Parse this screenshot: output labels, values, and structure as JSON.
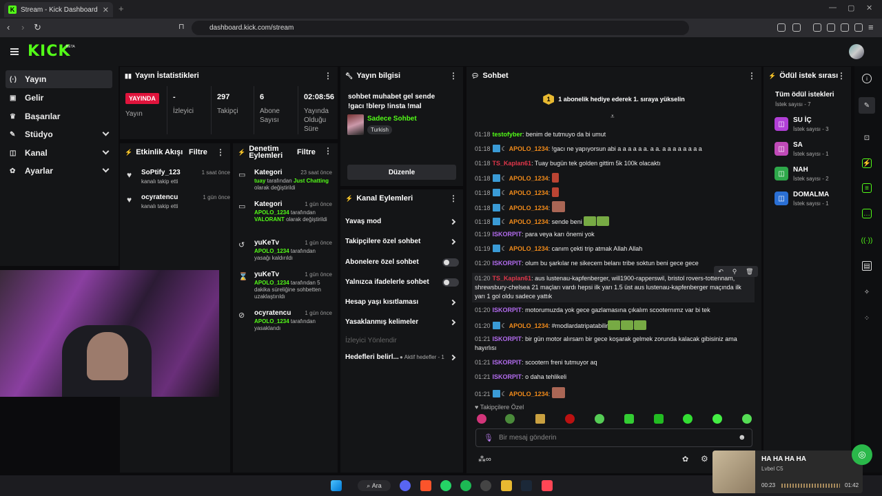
{
  "browser": {
    "tab_title": "Stream - Kick Dashboard",
    "url": "dashboard.kick.com/stream"
  },
  "app": {
    "logo": "KICK",
    "beta": "BETA"
  },
  "sidebar": {
    "items": [
      {
        "label": "Yayın",
        "icon": "broadcast-icon"
      },
      {
        "label": "Gelir",
        "icon": "wallet-icon"
      },
      {
        "label": "Başarılar",
        "icon": "trophy-icon"
      },
      {
        "label": "Stüdyo",
        "icon": "studio-icon"
      },
      {
        "label": "Kanal",
        "icon": "channel-icon"
      },
      {
        "label": "Ayarlar",
        "icon": "gear-icon"
      }
    ]
  },
  "stats": {
    "title": "Yayın İstatistikleri",
    "cells": [
      {
        "value": "YAYINDA",
        "label": "Yayın"
      },
      {
        "value": "-",
        "label": "İzleyici"
      },
      {
        "value": "297",
        "label": "Takipçi"
      },
      {
        "value": "6",
        "label": "Abone Sayısı"
      },
      {
        "value": "02:08:56",
        "label": "Yayında Olduğu Süre"
      }
    ]
  },
  "activity": {
    "title": "Etkinlik Akışı",
    "filter": "Filtre",
    "items": [
      {
        "name": "SoPtify_123",
        "sub": "kanalı takip etti",
        "time": "1 saat önce"
      },
      {
        "name": "ocyratencu",
        "sub": "kanalı takip etti",
        "time": "1 gün önce"
      }
    ]
  },
  "moderation": {
    "title": "Denetim Eylemleri",
    "filter": "Filtre",
    "items": [
      {
        "name": "Kategori",
        "time": "23 saat önce",
        "actor": "tuay",
        "mid": " tarafından ",
        "target": "Just Chatting",
        "tail": " olarak değiştirildi"
      },
      {
        "name": "Kategori",
        "time": "1 gün önce",
        "actor": "APOLO_1234",
        "mid": " tarafından ",
        "target": "VALORANT",
        "tail": " olarak değiştirildi"
      },
      {
        "name": "yuKeTv",
        "time": "1 gün önce",
        "actor": "APOLO_1234",
        "mid": " tarafından yasağı kaldırıldı",
        "target": "",
        "tail": ""
      },
      {
        "name": "yuKeTv",
        "time": "1 gün önce",
        "actor": "APOLO_1234",
        "mid": " tarafından 5 dakika süreliğine sohbetten uzaklaştırıldı",
        "target": "",
        "tail": ""
      },
      {
        "name": "ocyratencu",
        "time": "1 gün önce",
        "actor": "APOLO_1234",
        "mid": " tarafından yasaklandı",
        "target": "",
        "tail": ""
      }
    ]
  },
  "stream_info": {
    "title": "Yayın bilgisi",
    "stream_title": "sohbet muhabet gel sende !gacı !blerp !insta !mal",
    "category": "Sadece Sohbet",
    "language": "Turkish",
    "edit_label": "Düzenle"
  },
  "channel_actions": {
    "title": "Kanal Eylemleri",
    "items": [
      {
        "label": "Yavaş mod",
        "kind": "chevron"
      },
      {
        "label": "Takipçilere özel sohbet",
        "kind": "chevron"
      },
      {
        "label": "Abonelere özel sohbet",
        "kind": "toggle"
      },
      {
        "label": "Yalnızca ifadelerle sohbet",
        "kind": "toggle"
      },
      {
        "label": "Hesap yaşı kısıtlaması",
        "kind": "chevron"
      },
      {
        "label": "Yasaklanmış kelimeler",
        "kind": "chevron"
      },
      {
        "label": "İzleyici Yönlendir",
        "kind": "disabled"
      },
      {
        "label": "Hedefleri belirl...",
        "kind": "chevron"
      }
    ],
    "goal_tag": "● Aktif hedefler - 1"
  },
  "chat": {
    "title": "Sohbet",
    "pinned": "1 abonelik hediye ederek 1. sıraya yükselin",
    "pinned_number": "1",
    "messages": [
      {
        "time": "01:18",
        "user": "testofyber",
        "color": "#53fc18",
        "badges": false,
        "text": "benim de tutmuyo da bi umut"
      },
      {
        "time": "01:18",
        "user": "APOLO_1234",
        "color": "#f08a1a",
        "badges": true,
        "text": "!gacı ne yapıyorsun abi a a a a a a. a a. a a a a a a a a"
      },
      {
        "time": "01:18",
        "user": "TS_Kaplan61",
        "color": "#e0364a",
        "badges": false,
        "text": "Tuay bugün tek golden gittim 5k 100k olacaktı"
      },
      {
        "time": "01:18",
        "user": "APOLO_1234",
        "color": "#f08a1a",
        "badges": true,
        "text": "",
        "emote": "red"
      },
      {
        "time": "01:18",
        "user": "APOLO_1234",
        "color": "#f08a1a",
        "badges": true,
        "text": "",
        "emote": "red"
      },
      {
        "time": "01:18",
        "user": "APOLO_1234",
        "color": "#f08a1a",
        "badges": true,
        "text": "",
        "emote": "pic"
      },
      {
        "time": "01:18",
        "user": "APOLO_1234",
        "color": "#f08a1a",
        "badges": true,
        "text": "sende beni",
        "emote": "green2"
      },
      {
        "time": "01:19",
        "user": "ISKORPIT",
        "color": "#b46cf0",
        "badges": false,
        "text": "para veya karı önemi yok"
      },
      {
        "time": "01:19",
        "user": "APOLO_1234",
        "color": "#f08a1a",
        "badges": true,
        "text": "canım çekti trip atmak Allah Allah"
      },
      {
        "time": "01:20",
        "user": "ISKORPIT",
        "color": "#b46cf0",
        "badges": false,
        "text": "olum bu şarkılar ne sikecem belanı tribe soktun beni gece gece"
      },
      {
        "time": "01:20",
        "user": "TS_Kaplan61",
        "color": "#e0364a",
        "badges": false,
        "text": "aus lustenau-kapfenberger, will1900-rapperswil, bristol rovers-tottenham, shrewsbury-chelsea 21 maçları vardı hepsi ilk yarı 1.5 üst aus lustenau-kapfenberger maçında ilk yarı 1 gol oldu sadece yattık",
        "highlight": true
      },
      {
        "time": "01:20",
        "user": "ISKORPIT",
        "color": "#b46cf0",
        "badges": false,
        "text": "motorumuzda yok gece gazlamasına çıkalım scooternımz var bi tek"
      },
      {
        "time": "01:20",
        "user": "APOLO_1234",
        "color": "#f08a1a",
        "badges": true,
        "text": "#modlardatripatabilir",
        "emote": "green3"
      },
      {
        "time": "01:21",
        "user": "ISKORPIT",
        "color": "#b46cf0",
        "badges": false,
        "text": "bir gün motor alırsam bir gece koşarak gelmek zorunda kalacak gibisiniz ama hayırlısı"
      },
      {
        "time": "01:21",
        "user": "ISKORPIT",
        "color": "#b46cf0",
        "badges": false,
        "text": "scootern freni tutmuyor aq"
      },
      {
        "time": "01:21",
        "user": "ISKORPIT",
        "color": "#b46cf0",
        "badges": false,
        "text": "o daha tehlikeli"
      },
      {
        "time": "01:21",
        "user": "APOLO_1234",
        "color": "#f08a1a",
        "badges": true,
        "text": "",
        "emote": "pic"
      }
    ],
    "followers_only": "Takipçilere Özel",
    "input_placeholder": "Bir mesaj gönderin"
  },
  "rewards": {
    "title": "Ödül istek sırası",
    "all_label": "Tüm ödül istekleri",
    "all_count": "İstek sayısı - 7",
    "items": [
      {
        "name": "SU İÇ",
        "count": "İstek sayısı - 3",
        "color": "#b13fd6"
      },
      {
        "name": "SA",
        "count": "İstek sayısı - 1",
        "color": "#c04ab8"
      },
      {
        "name": "NAH",
        "count": "İstek sayısı - 2",
        "color": "#2ea84a"
      },
      {
        "name": "DOMALMA",
        "count": "İstek sayısı - 1",
        "color": "#2a6fd4"
      }
    ]
  },
  "taskbar": {
    "search": "Ara"
  },
  "music": {
    "track": "HA HA HA HA",
    "artist": "Lvbel C5",
    "elapsed": "00:23",
    "total": "01:42"
  }
}
